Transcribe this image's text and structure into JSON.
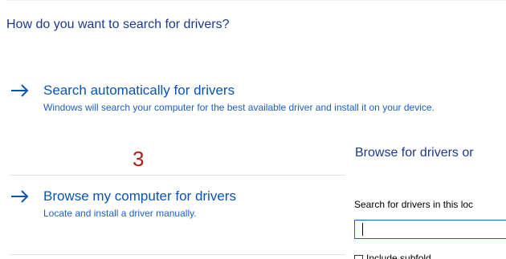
{
  "dialog": {
    "heading": "How do you want to search for drivers?",
    "options": [
      {
        "title": "Search automatically for drivers",
        "description": "Windows will search your computer for the best available driver and install it on your device.",
        "icon": "arrow-right-icon"
      },
      {
        "title": "Browse my computer for drivers",
        "description": "Locate and install a driver manually.",
        "icon": "arrow-right-icon"
      }
    ]
  },
  "annotation": {
    "step_number": "3",
    "color": "#b31a1a"
  },
  "browse_panel": {
    "title": "Browse for drivers or",
    "search_label": "Search for drivers in this loc",
    "path_value": "",
    "include_subfolders_label": "Include subfold"
  },
  "colors": {
    "heading": "#1c3a8c",
    "link": "#0a53b5",
    "description": "#1e5fbf",
    "input_border": "#1e5fbf"
  }
}
